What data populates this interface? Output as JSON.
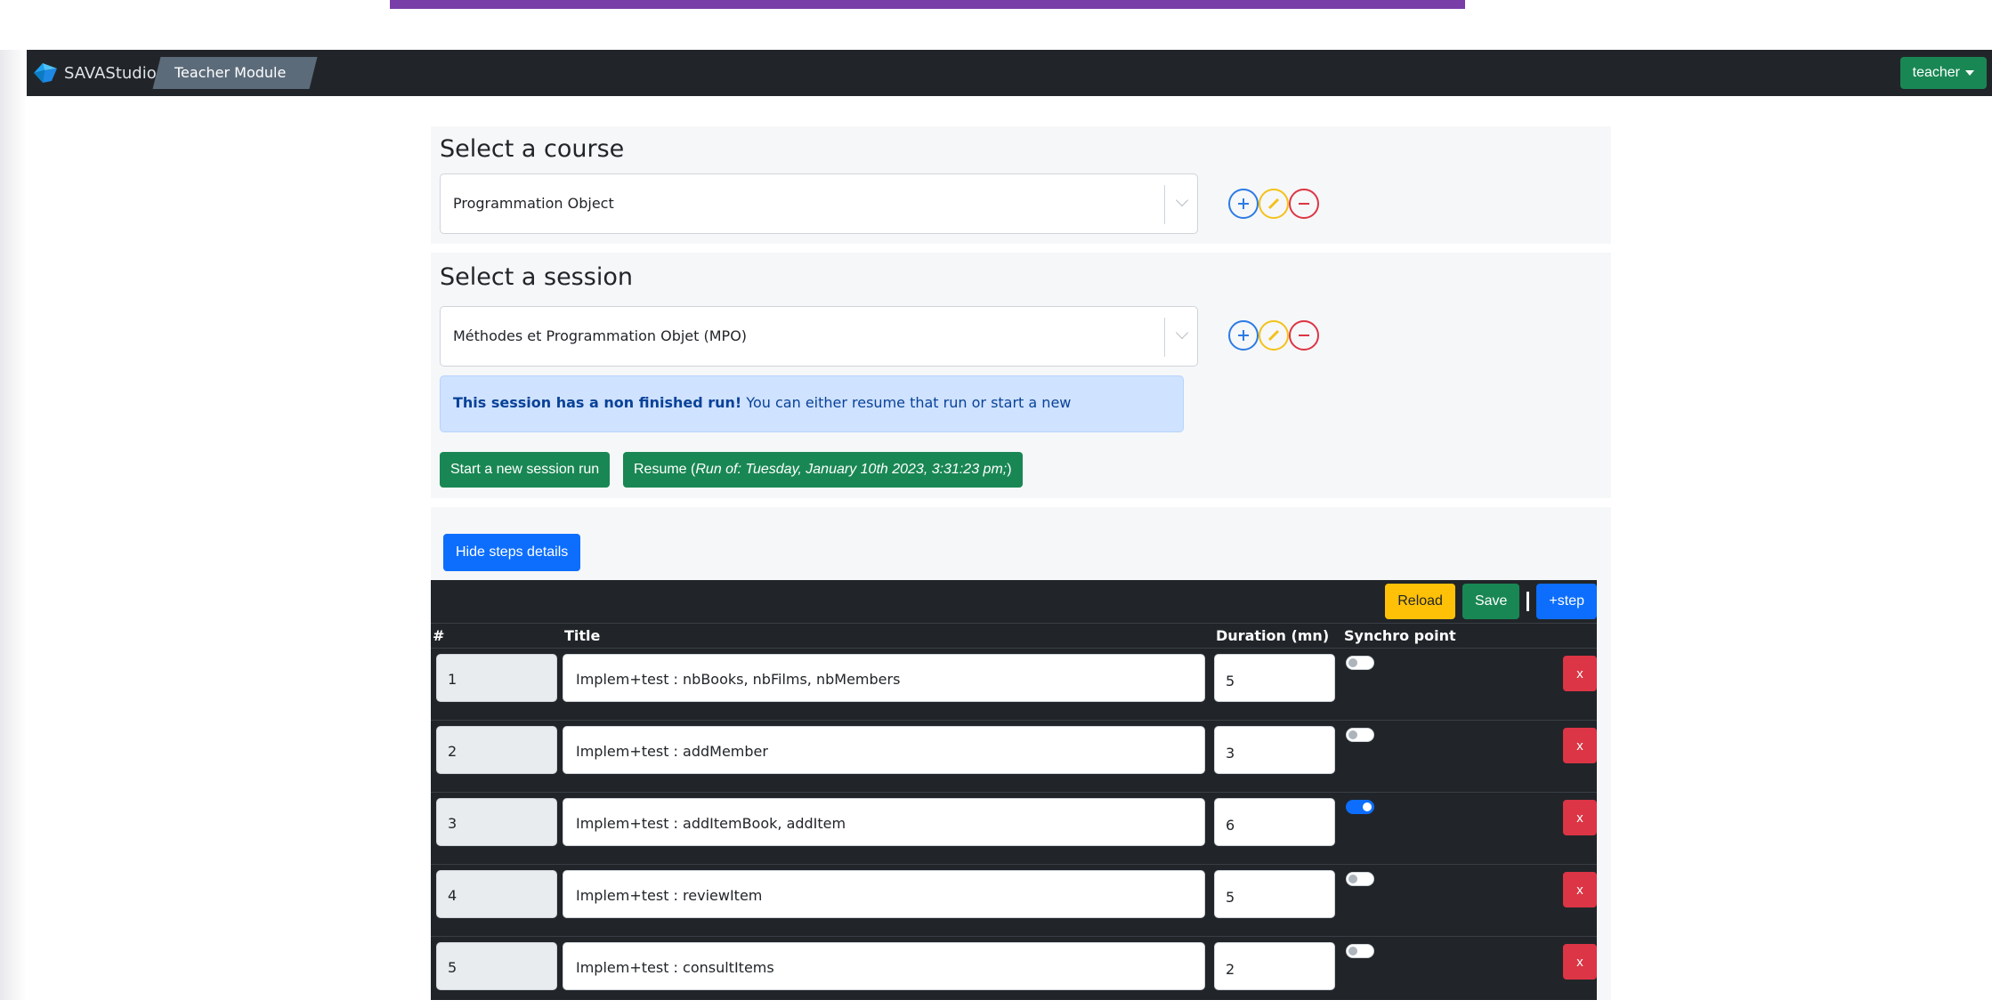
{
  "navbar": {
    "brand": "SAVAStudio",
    "module": "Teacher Module",
    "user": "teacher"
  },
  "course": {
    "title": "Select a course",
    "selected": "Programmation Object"
  },
  "session": {
    "title": "Select a session",
    "selected": "Méthodes et Programmation Objet (MPO)",
    "alert_bold": "This session has a non finished run!",
    "alert_text": " You can either resume that run or start a new",
    "start_label": "Start a new session run",
    "resume_label": "Resume (",
    "resume_italic": "Run of: Tuesday, January 10th 2023, 3:31:23 pm;",
    "resume_close": ")"
  },
  "steps": {
    "toggle_label": "Hide steps details",
    "reload_label": "Reload",
    "save_label": "Save",
    "add_step_label": "+step",
    "columns": [
      "#",
      "Title",
      "Duration (mn)",
      "Synchro point"
    ],
    "delete_label": "x",
    "rows": [
      {
        "num": "1",
        "title": "Implem+test : nbBooks, nbFilms, nbMembers",
        "duration": "5",
        "synchro": false
      },
      {
        "num": "2",
        "title": "Implem+test : addMember",
        "duration": "3",
        "synchro": false
      },
      {
        "num": "3",
        "title": "Implem+test : addItemBook, addItem",
        "duration": "6",
        "synchro": true
      },
      {
        "num": "4",
        "title": "Implem+test : reviewItem",
        "duration": "5",
        "synchro": false
      },
      {
        "num": "5",
        "title": "Implem+test : consultItems",
        "duration": "2",
        "synchro": false
      }
    ]
  },
  "colors": {
    "navbar": "#212529",
    "success": "#198754",
    "primary": "#0d6efd",
    "warning": "#ffc107",
    "danger": "#dc3545",
    "alert_bg": "#cfe2ff"
  }
}
